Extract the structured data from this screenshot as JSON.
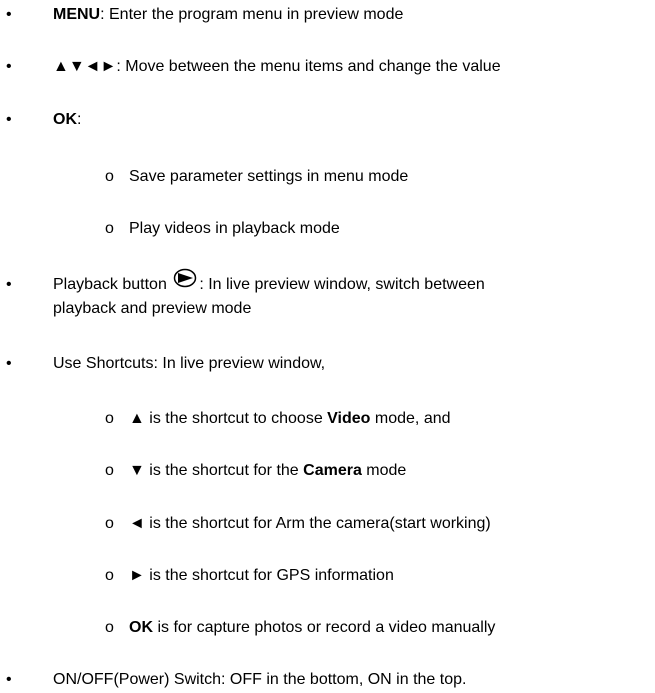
{
  "items": [
    {
      "bold": "MENU",
      "rest": ": Enter the program menu in preview mode"
    },
    {
      "arrows": "▲▼◄►",
      "rest": ": Move between the menu items and change the value"
    },
    {
      "bold": "OK",
      "rest": ":"
    },
    {
      "sub": "Save parameter settings in menu mode"
    },
    {
      "sub": "Play videos in playback mode"
    },
    {
      "prefix": "Playback button",
      "rest": ": In live preview window, switch between",
      "line2": "playback and preview mode"
    },
    {
      "text": "Use Shortcuts: In live preview window,"
    },
    {
      "arrow": "▲",
      "pre": " is the shortcut to choose ",
      "bold": "Video",
      "post": " mode, and"
    },
    {
      "arrow": "▼",
      "pre": " is the shortcut for the ",
      "bold": "Camera",
      "post": " mode"
    },
    {
      "arrow": "◄",
      "text": " is the shortcut for Arm the camera(start working)"
    },
    {
      "arrow": "►",
      "text": " is the shortcut for GPS information"
    },
    {
      "bold": "OK",
      "text": " is for capture photos or record a video manually"
    },
    {
      "text": "ON/OFF(Power) Switch: OFF in the bottom, ON in the top."
    }
  ],
  "glyphs": {
    "bullet": "•",
    "sub_bullet": "o"
  },
  "icons": {
    "playback": "playback-button-icon"
  }
}
